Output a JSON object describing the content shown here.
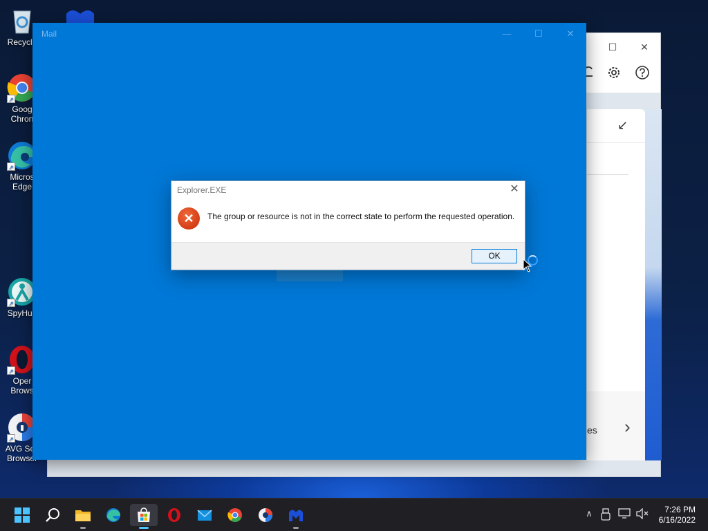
{
  "desktop": {
    "icons": [
      {
        "label": "Recycle",
        "icon": "recycle-bin-icon"
      },
      {
        "label": "Goog\nChron",
        "icon": "chrome-icon"
      },
      {
        "label": "Micros\nEdge",
        "icon": "edge-icon"
      },
      {
        "label": "SpyHun",
        "icon": "spyhunter-icon"
      },
      {
        "label": "Oper\nBrows",
        "icon": "opera-icon"
      },
      {
        "label": "AVG Sec\nBrowser",
        "icon": "avg-browser-icon"
      }
    ]
  },
  "background_window": {
    "buttons": {
      "maximize": "☐",
      "close": "✕"
    },
    "icons": [
      "bell-icon",
      "settings-gear-icon",
      "help-icon"
    ],
    "collapse_glyph": "↙",
    "partial_text": "es",
    "chevron": "›"
  },
  "mail_window": {
    "title": "Mail",
    "buttons": {
      "minimize": "—",
      "maximize": "☐",
      "close": "✕"
    }
  },
  "dialog": {
    "title": "Explorer.EXE",
    "message": "The group or resource is not in the correct state to perform the requested operation.",
    "ok_label": "OK",
    "close_glyph": "✕",
    "error_glyph": "✕"
  },
  "taskbar": {
    "items": [
      "start-icon",
      "search-icon",
      "file-explorer-icon",
      "edge-icon",
      "microsoft-store-icon",
      "opera-icon",
      "mail-icon",
      "chrome-icon",
      "avg-browser-icon",
      "malwarebytes-icon"
    ],
    "active_item": "microsoft-store-icon",
    "tray": {
      "chevron": "∧"
    },
    "clock": {
      "time": "7:26 PM",
      "date": "6/16/2022"
    }
  },
  "colors": {
    "mail_blue": "#0078d7",
    "error_red": "#d9421a",
    "taskbar_accent": "#4cc2ff"
  }
}
